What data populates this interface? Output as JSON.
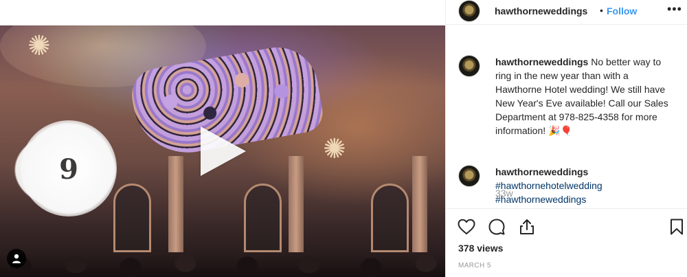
{
  "post": {
    "username": "hawthorneweddings",
    "follow_label": "Follow",
    "separator": "•",
    "video_overlay_number": "9"
  },
  "comments": [
    {
      "username": "hawthorneweddings",
      "text": "No better way to ring in the new year than with a Hawthorne Hotel wedding! We still have New Year's Eve available! Call our Sales Department at 978-825-4358 for more information! 🎉🎈",
      "time": "33w"
    },
    {
      "username": "hawthorneweddings",
      "hashtags": [
        "#hawthornehotelwedding",
        "#hawthorneweddings"
      ]
    }
  ],
  "stats": {
    "views": "378 views",
    "date": "MARCH 5"
  },
  "icons": {
    "more": "more-options-icon",
    "like": "heart-icon",
    "comment": "comment-icon",
    "share": "share-icon",
    "save": "bookmark-icon",
    "play": "play-icon",
    "user_tag": "user-tag-icon"
  },
  "colors": {
    "link": "#3897f0",
    "hashtag": "#003569",
    "muted": "#999999",
    "text": "#262626"
  }
}
